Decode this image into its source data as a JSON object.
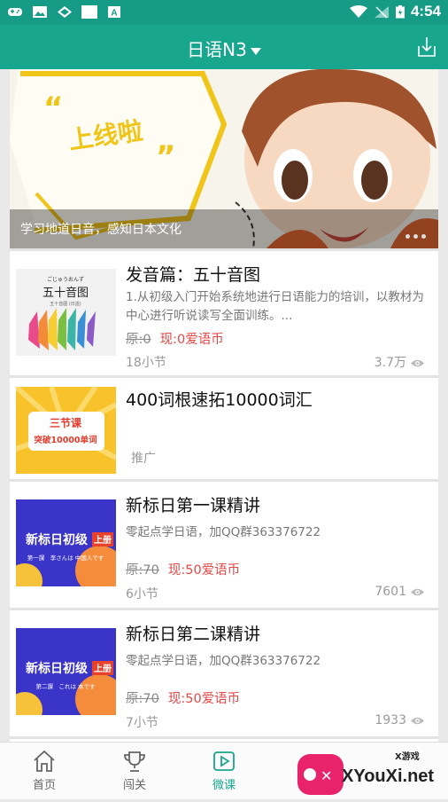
{
  "status": {
    "time": "4:54"
  },
  "header": {
    "title": "日语N3",
    "download_icon": "download-icon"
  },
  "banner": {
    "caption": "学习地道日音，感知日本文化",
    "bubble_text": "上线啦",
    "quote_left": "“",
    "quote_right": "”"
  },
  "courses": [
    {
      "title": "发音篇：五十音图",
      "description": "1.从初级入门开始系统地进行日语能力的培训，以教材为中心进行听说读写全面训练。...",
      "price_old": "原:0",
      "price_now": "现:0爱语币",
      "lessons": "18小节",
      "views": "3.7万",
      "thumb_small": "ごじゅうおんず",
      "thumb_main": "五十音图",
      "thumb_sub": "五十音图 (日語)"
    },
    {
      "title": "400词根速拓10000词汇",
      "tag": "推广",
      "thumb_ribbon": "三节课",
      "thumb_main": "突破10000单词"
    },
    {
      "title": "新标日第一课精讲",
      "description": "零起点学日语，加QQ群363376722",
      "price_old": "原:70",
      "price_now": "现:50爱语币",
      "lessons": "6小节",
      "views": "7601",
      "thumb_main": "新标日初级",
      "thumb_badge": "上册",
      "thumb_sub": "第一課　李さんは 中国人です"
    },
    {
      "title": "新标日第二课精讲",
      "description": "零起点学日语，加QQ群363376722",
      "price_old": "原:70",
      "price_now": "现:50爱语币",
      "lessons": "7小节",
      "views": "1933",
      "thumb_main": "新标日初级",
      "thumb_badge": "上册",
      "thumb_sub": "第二課　これは 本です"
    }
  ],
  "tabs": [
    {
      "label": "首页",
      "icon": "home-icon"
    },
    {
      "label": "闯关",
      "icon": "trophy-icon"
    },
    {
      "label": "微课",
      "icon": "play-icon",
      "active": true
    }
  ],
  "watermark": {
    "brand": "XYouXi.net",
    "small": "X游戏"
  },
  "colors": {
    "primary": "#18a68f",
    "price": "#e54747",
    "status_bar": "#159b86"
  }
}
